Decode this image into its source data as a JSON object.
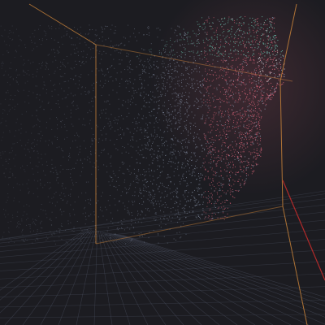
{
  "viewport": {
    "background": "#1c1c21",
    "grid_color": "#4a5060",
    "bounding_box_color": "#c8823a",
    "axis_color": "#b02a2a",
    "point_cloud_colors": [
      "#6fd0b8",
      "#9aa7c0",
      "#e0677c",
      "#f2f2f2"
    ]
  }
}
